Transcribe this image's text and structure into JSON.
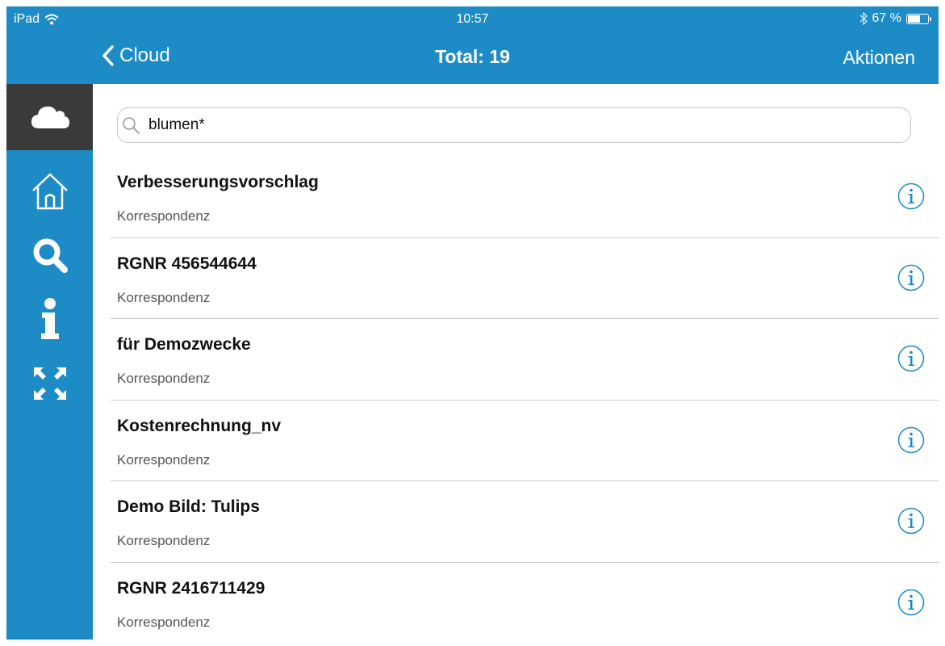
{
  "status_bar": {
    "device": "iPad",
    "time": "10:57",
    "battery": "67 %",
    "battery_level": 0.67
  },
  "nav": {
    "back_label": "Cloud",
    "title": "Total: 19",
    "action_label": "Aktionen"
  },
  "sidebar": {
    "items": [
      {
        "icon": "cloud-icon",
        "active": true
      },
      {
        "icon": "home-icon",
        "active": false
      },
      {
        "icon": "search-icon",
        "active": false
      },
      {
        "icon": "info-icon",
        "active": false
      },
      {
        "icon": "expand-icon",
        "active": false
      }
    ]
  },
  "search": {
    "value": "blumen*"
  },
  "results": [
    {
      "title": "Verbesserungsvorschlag",
      "subtitle": "Korrespondenz"
    },
    {
      "title": "RGNR 456544644",
      "subtitle": "Korrespondenz"
    },
    {
      "title": "für Demozwecke",
      "subtitle": "Korrespondenz"
    },
    {
      "title": "Kostenrechnung_nv",
      "subtitle": "Korrespondenz"
    },
    {
      "title": "Demo Bild: Tulips",
      "subtitle": "Korrespondenz"
    },
    {
      "title": "RGNR 2416711429",
      "subtitle": "Korrespondenz"
    }
  ],
  "colors": {
    "brand": "#1d8cc6",
    "sidebar_active": "#3a3a3a",
    "info_icon": "#1d8cc6"
  }
}
